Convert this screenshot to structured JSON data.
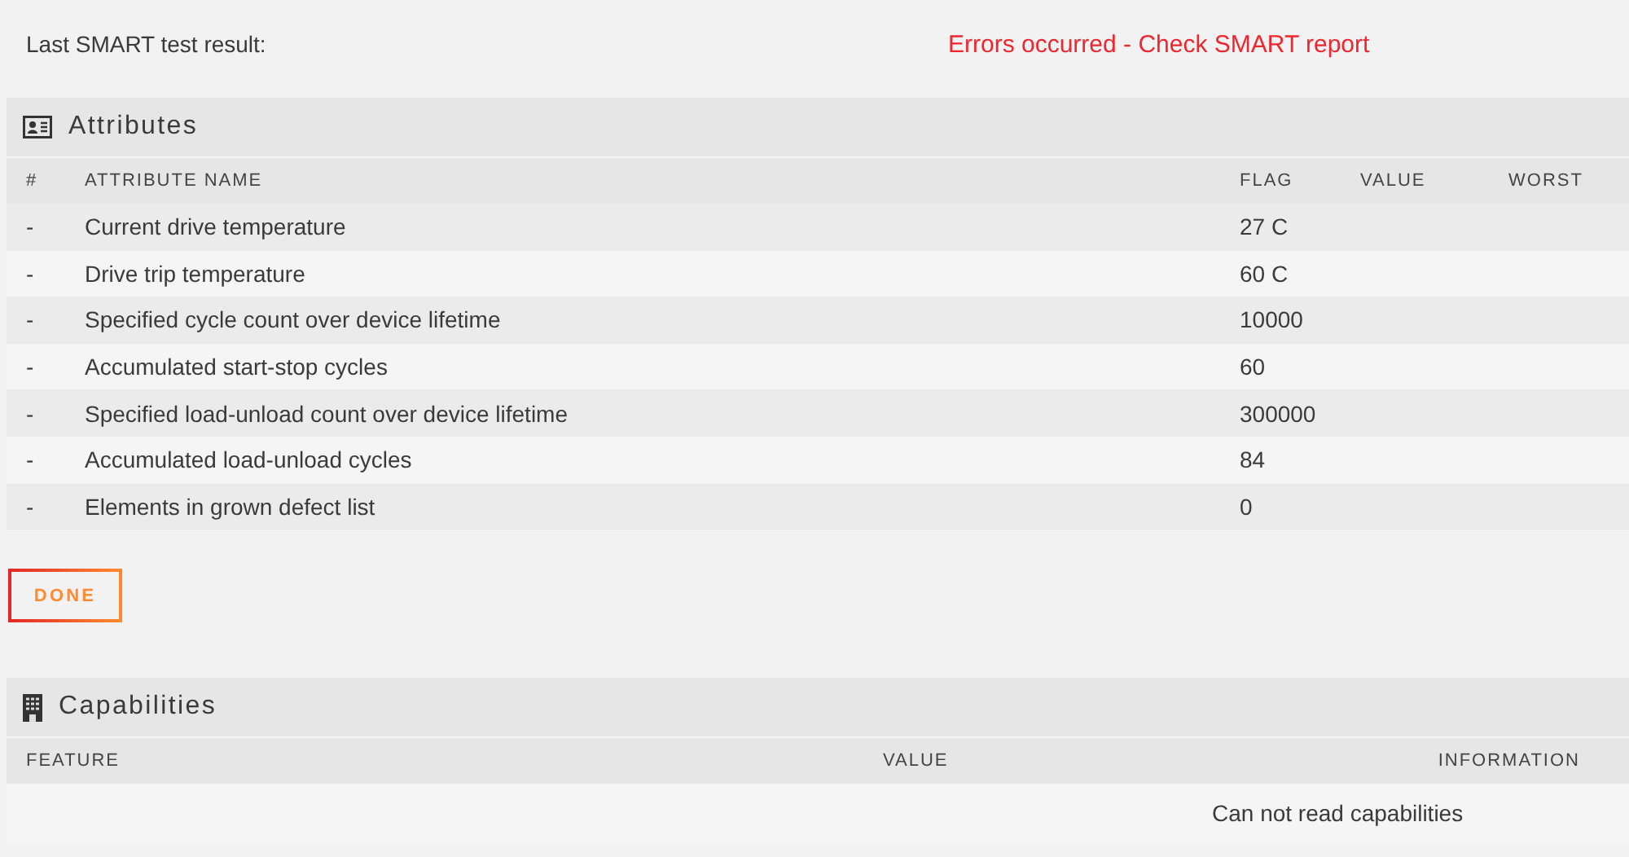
{
  "test_result": {
    "label": "Last SMART test result:",
    "value": "Errors occurred - Check SMART report"
  },
  "attributes": {
    "title": "Attributes",
    "columns": [
      "#",
      "ATTRIBUTE NAME",
      "FLAG",
      "VALUE",
      "WORST"
    ],
    "rows": [
      [
        "-",
        "Current drive temperature",
        "27 C",
        "",
        ""
      ],
      [
        "-",
        "Drive trip temperature",
        "60 C",
        "",
        ""
      ],
      [
        "-",
        "Specified cycle count over device lifetime",
        "10000",
        "",
        ""
      ],
      [
        "-",
        "Accumulated start-stop cycles",
        "60",
        "",
        ""
      ],
      [
        "-",
        "Specified load-unload count over device lifetime",
        "300000",
        "",
        ""
      ],
      [
        "-",
        "Accumulated load-unload cycles",
        "84",
        "",
        ""
      ],
      [
        "-",
        "Elements in grown defect list",
        "0",
        "",
        ""
      ]
    ]
  },
  "done_button": "DONE",
  "capabilities": {
    "title": "Capabilities",
    "columns": [
      "FEATURE",
      "VALUE",
      "INFORMATION"
    ],
    "message": "Can not read capabilities"
  }
}
